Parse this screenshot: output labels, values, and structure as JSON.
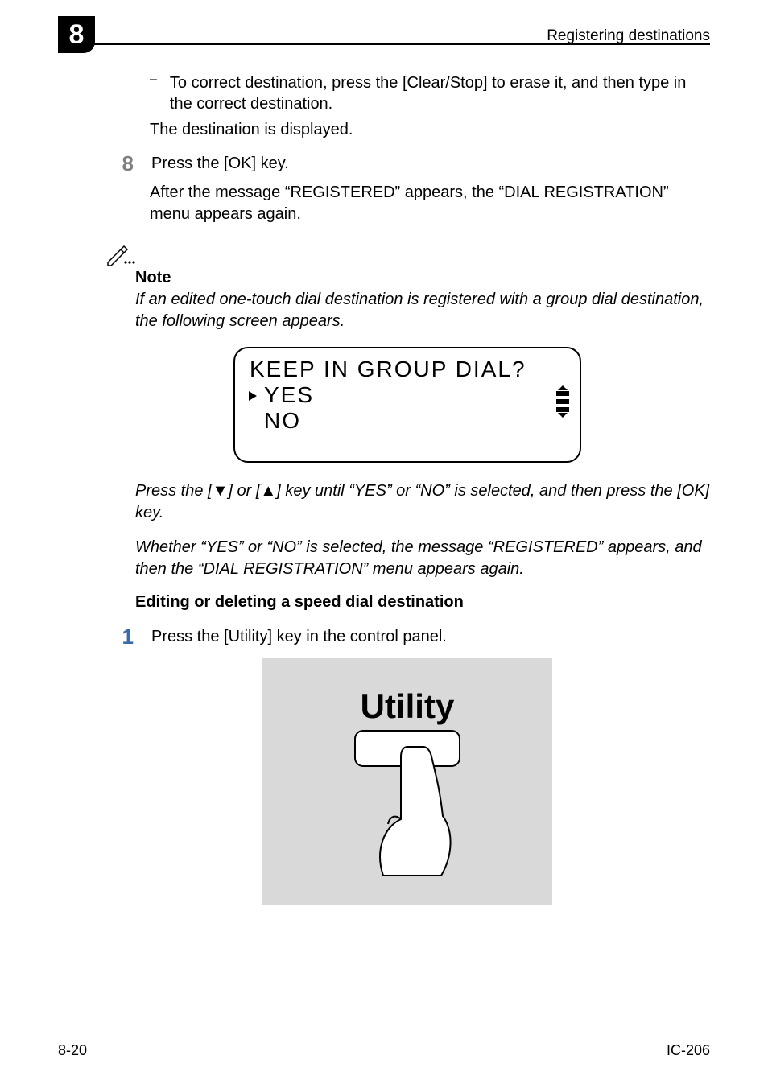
{
  "chapter_number": "8",
  "running_header": "Registering destinations",
  "correction_bullet": "To correct destination, press the [Clear/Stop] to erase it, and then type in the correct destination.",
  "destination_displayed": "The destination is displayed.",
  "step8": {
    "num": "8",
    "text": "Press the [OK] key.",
    "after": "After the message “REGISTERED” appears, the “DIAL REGISTRATION” menu appears again."
  },
  "note": {
    "heading": "Note",
    "body": "If an edited one-touch dial destination is registered with a group dial destination, the following screen appears."
  },
  "lcd": {
    "line1": "KEEP IN GROUP DIAL?",
    "yes": "YES",
    "no": "NO"
  },
  "note2a": "Press the [,] or [+] key until “YES” or “NO” is selected, and then press the [OK] key.",
  "note2a_prefix": "Press the [",
  "note2a_mid1": "] or [",
  "note2a_mid2": "] key until “YES” or “NO” is selected, and then press the [OK] key.",
  "note2b": "Whether “YES” or “NO” is selected, the message “REGISTERED” appears, and then the “DIAL REGISTRATION” menu appears again.",
  "section_heading": "Editing or deleting a speed dial destination",
  "step1": {
    "num": "1",
    "text": "Press the [Utility] key in the control panel."
  },
  "utility_label": "Utility",
  "footer_left": "8-20",
  "footer_right": "IC-206"
}
